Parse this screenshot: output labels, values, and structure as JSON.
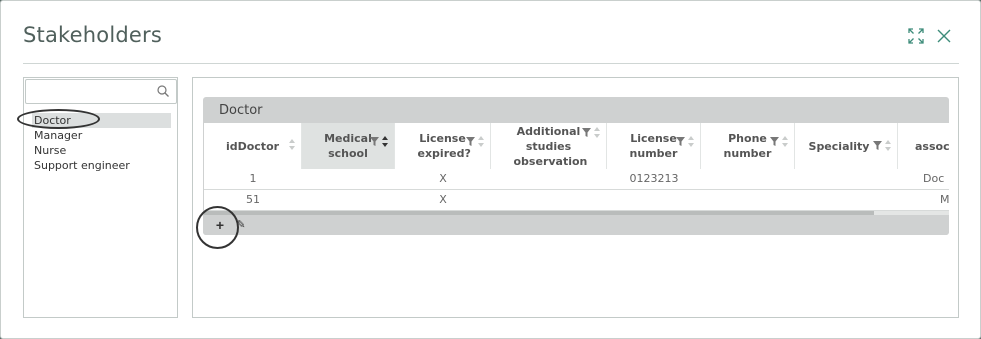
{
  "dialog": {
    "title": "Stakeholders"
  },
  "search": {
    "value": "",
    "placeholder": ""
  },
  "stakeholders": [
    {
      "label": "Doctor",
      "selected": true
    },
    {
      "label": "Manager",
      "selected": false
    },
    {
      "label": "Nurse",
      "selected": false
    },
    {
      "label": "Support engineer",
      "selected": false
    }
  ],
  "grid": {
    "title": "Doctor",
    "columns": [
      {
        "label": "idDoctor",
        "filter": false,
        "sort": "none"
      },
      {
        "label": "Medical school",
        "filter": true,
        "sort": "active"
      },
      {
        "label": "License expired?",
        "filter": true,
        "sort": "none"
      },
      {
        "label": "Additional studies observation",
        "filter": true,
        "sort": "none"
      },
      {
        "label": "License number",
        "filter": true,
        "sort": "none"
      },
      {
        "label": "Phone number",
        "filter": true,
        "sort": "none"
      },
      {
        "label": "Speciality",
        "filter": true,
        "sort": "none"
      },
      {
        "label": "associ",
        "filter": false,
        "sort": "none"
      }
    ],
    "rows": [
      [
        "1",
        "",
        "X",
        "",
        "0123213",
        "",
        "",
        "Doc"
      ],
      [
        "51",
        "",
        "X",
        "",
        "",
        "",
        "",
        "M"
      ]
    ],
    "toolbar": {
      "add_label": "+",
      "edit_label": "✎"
    }
  },
  "icons": {
    "maximize": "maximize-icon",
    "close": "close-icon",
    "search": "search-icon",
    "filter": "filter-icon",
    "sort": "sort-icon"
  },
  "colors": {
    "accent": "#3d8c7a",
    "title_text": "#50605c",
    "grid_header_band": "#cfd1d1",
    "selected_row": "#dcdfdf"
  }
}
